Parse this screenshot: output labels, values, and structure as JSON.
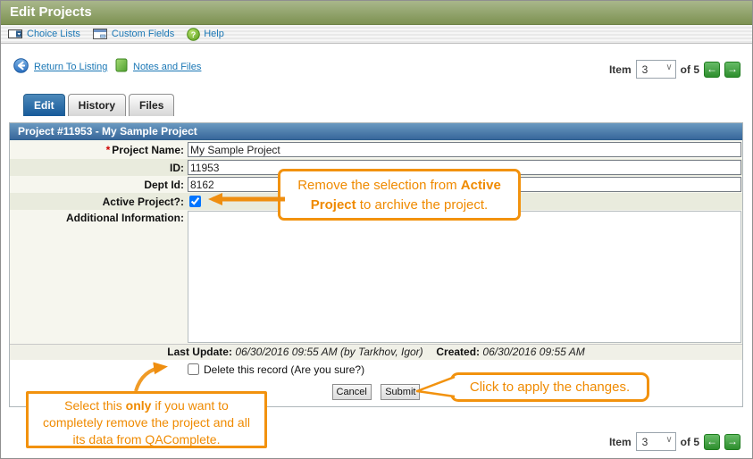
{
  "header": {
    "title": "Edit Projects"
  },
  "toolbar": {
    "choice_lists": "Choice Lists",
    "custom_fields": "Custom Fields",
    "help": "Help"
  },
  "links": {
    "return_to_listing": "Return To Listing",
    "notes_and_files": "Notes and Files"
  },
  "pager": {
    "item_label": "Item",
    "selected": "3",
    "of_label": "of 5"
  },
  "icons": {
    "dropdown_chevron": "∨",
    "prev_arrow": "←",
    "next_arrow": "→",
    "help_glyph": "?"
  },
  "tabs": [
    {
      "label": "Edit",
      "active": true
    },
    {
      "label": "History",
      "active": false
    },
    {
      "label": "Files",
      "active": false
    }
  ],
  "form": {
    "title": "Project #11953 - My Sample Project",
    "project_name": {
      "required_marker": "*",
      "label": "Project Name:",
      "value": "My Sample Project"
    },
    "id": {
      "label": "ID:",
      "value": "11953"
    },
    "dept_id": {
      "label": "Dept Id:",
      "value": "8162"
    },
    "active_project": {
      "label": "Active Project?:",
      "checked": true
    },
    "additional_info": {
      "label": "Additional Information:",
      "value": ""
    },
    "last_update": {
      "label": "Last Update:",
      "value": "06/30/2016 09:55 AM (by Tarkhov, Igor)",
      "created_label": "Created:",
      "created_value": "06/30/2016 09:55 AM"
    },
    "delete": {
      "label": "Delete this record (Are you sure?)",
      "checked": false
    },
    "buttons": {
      "cancel": "Cancel",
      "submit": "Submit"
    }
  },
  "callouts": {
    "active_project": {
      "before": "Remove the selection from ",
      "bold": "Active Project",
      "after": " to archive the project."
    },
    "delete": {
      "before": "Select this ",
      "bold": "only",
      "after": " if you want to completely remove the project and all its data from QAComplete."
    },
    "submit": {
      "text": "Click to apply the changes."
    }
  },
  "colors": {
    "accent_orange": "#ef8a00",
    "header_green": "#7d9252",
    "form_title_blue": "#38679b",
    "link_blue": "#1a77b5",
    "pager_green": "#2e8e2e"
  }
}
